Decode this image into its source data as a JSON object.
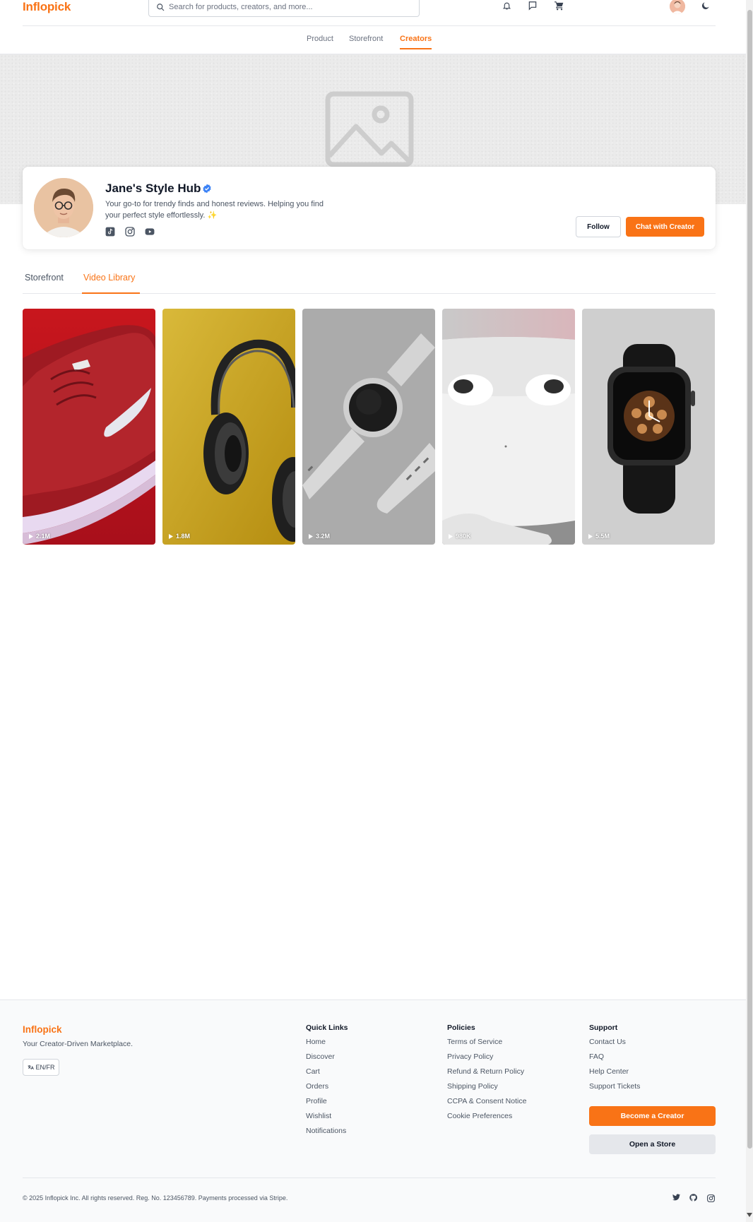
{
  "header": {
    "logo": "Inflopick",
    "search_placeholder": "Search for products, creators, and more..."
  },
  "topnav": {
    "items": [
      "Product",
      "Storefront",
      "Creators"
    ],
    "active": "Creators"
  },
  "creator": {
    "name": "Jane's Style Hub",
    "bio": "Your go-to for trendy finds and honest reviews. Helping you find your perfect style effortlessly. ✨",
    "follow_label": "Follow",
    "chat_label": "Chat with Creator"
  },
  "tabs": {
    "storefront": "Storefront",
    "video_library": "Video Library",
    "active": "Video Library"
  },
  "videos": [
    {
      "views": "2.1M",
      "icon": "sneaker"
    },
    {
      "views": "1.8M",
      "icon": "headphones"
    },
    {
      "views": "3.2M",
      "icon": "watch"
    },
    {
      "views": "980K",
      "icon": "earbuds"
    },
    {
      "views": "5.5M",
      "icon": "smartwatch"
    }
  ],
  "footer": {
    "logo": "Inflopick",
    "tagline": "Your Creator-Driven Marketplace.",
    "lang": "EN/FR",
    "quick_links": {
      "title": "Quick Links",
      "items": [
        "Home",
        "Discover",
        "Cart",
        "Orders",
        "Profile",
        "Wishlist",
        "Notifications"
      ]
    },
    "policies": {
      "title": "Policies",
      "items": [
        "Terms of Service",
        "Privacy Policy",
        "Refund & Return Policy",
        "Shipping Policy",
        "CCPA & Consent Notice",
        "Cookie Preferences"
      ]
    },
    "support": {
      "title": "Support",
      "items": [
        "Contact Us",
        "FAQ",
        "Help Center",
        "Support Tickets"
      ]
    },
    "become_creator": "Become a Creator",
    "open_store": "Open a Store",
    "copyright": "© 2025 Inflopick Inc. All rights reserved. Reg. No. 123456789. Payments processed via Stripe."
  },
  "colors": {
    "accent": "#f97316",
    "verified": "#3b82f6"
  }
}
